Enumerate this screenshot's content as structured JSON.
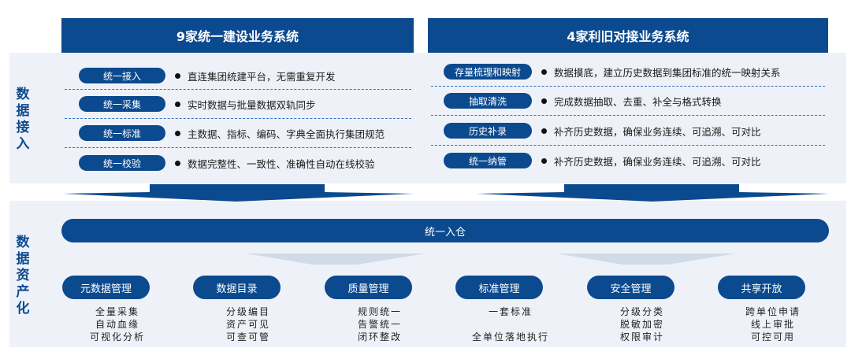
{
  "side_labels": {
    "data_access": "数据接入",
    "data_assetization": "数据资产化"
  },
  "left_panel": {
    "title": "9家统一建设业务系统",
    "rows": [
      {
        "tag": "统一接入",
        "text": "直连集团统建平台，无需重复开发"
      },
      {
        "tag": "统一采集",
        "text": "实时数据与批量数据双轨同步"
      },
      {
        "tag": "统一标准",
        "text": "主数据、指标、编码、字典全面执行集团规范"
      },
      {
        "tag": "统一校验",
        "text": "数据完整性、一致性、准确性自动在线校验"
      }
    ]
  },
  "right_panel": {
    "title": "4家利旧对接业务系统",
    "rows": [
      {
        "tag": "存量梳理和映射",
        "text": "数据摸底，建立历史数据到集团标准的统一映射关系"
      },
      {
        "tag": "抽取清洗",
        "text": "完成数据抽取、去重、补全与格式转换"
      },
      {
        "tag": "历史补录",
        "text": "补齐历史数据，确保业务连续、可追溯、可对比"
      },
      {
        "tag": "统一纳管",
        "text": "补齐历史数据，确保业务连续、可追溯、可对比"
      }
    ]
  },
  "warehouse": "统一入仓",
  "capabilities": [
    {
      "label": "元数据管理",
      "lines": [
        "全量采集",
        "自动血缘",
        "可视化分析"
      ]
    },
    {
      "label": "数据目录",
      "lines": [
        "分级编目",
        "资产可见",
        "可查可管"
      ]
    },
    {
      "label": "质量管理",
      "lines": [
        "规则统一",
        "告警统一",
        "闭环整改"
      ]
    },
    {
      "label": "标准管理",
      "lines": [
        "一套标准",
        "",
        "全单位落地执行"
      ]
    },
    {
      "label": "安全管理",
      "lines": [
        "分级分类",
        "脱敏加密",
        "权限审计"
      ]
    },
    {
      "label": "共享开放",
      "lines": [
        "跨单位申请",
        "线上审批",
        "可控可用"
      ]
    }
  ],
  "colors": {
    "primary": "#0c4a8f",
    "band": "#eef2f8",
    "dash": "#2f6fc0",
    "arrow_light": "#cfdbe9"
  }
}
